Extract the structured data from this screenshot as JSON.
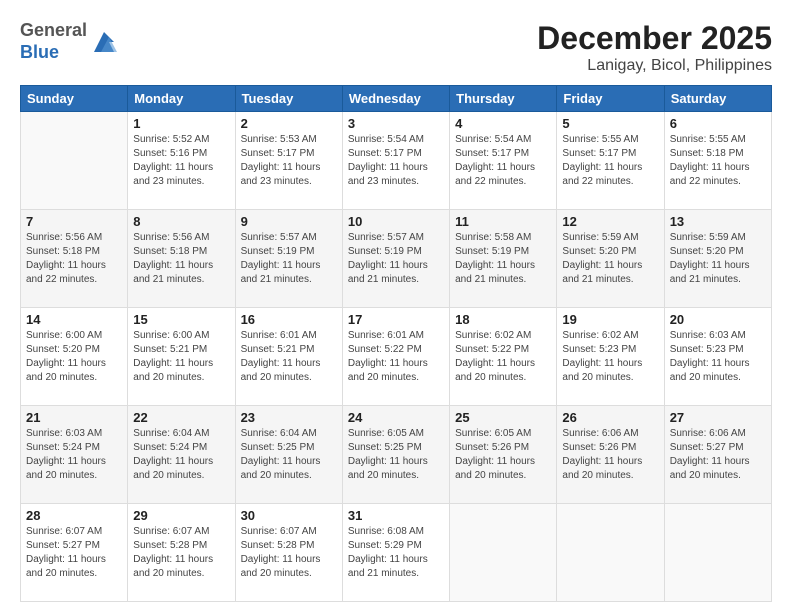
{
  "header": {
    "logo": {
      "text_general": "General",
      "text_blue": "Blue"
    },
    "title": "December 2025",
    "subtitle": "Lanigay, Bicol, Philippines"
  },
  "calendar": {
    "days_of_week": [
      "Sunday",
      "Monday",
      "Tuesday",
      "Wednesday",
      "Thursday",
      "Friday",
      "Saturday"
    ],
    "weeks": [
      [
        {
          "day": "",
          "info": ""
        },
        {
          "day": "1",
          "info": "Sunrise: 5:52 AM\nSunset: 5:16 PM\nDaylight: 11 hours\nand 23 minutes."
        },
        {
          "day": "2",
          "info": "Sunrise: 5:53 AM\nSunset: 5:17 PM\nDaylight: 11 hours\nand 23 minutes."
        },
        {
          "day": "3",
          "info": "Sunrise: 5:54 AM\nSunset: 5:17 PM\nDaylight: 11 hours\nand 23 minutes."
        },
        {
          "day": "4",
          "info": "Sunrise: 5:54 AM\nSunset: 5:17 PM\nDaylight: 11 hours\nand 22 minutes."
        },
        {
          "day": "5",
          "info": "Sunrise: 5:55 AM\nSunset: 5:17 PM\nDaylight: 11 hours\nand 22 minutes."
        },
        {
          "day": "6",
          "info": "Sunrise: 5:55 AM\nSunset: 5:18 PM\nDaylight: 11 hours\nand 22 minutes."
        }
      ],
      [
        {
          "day": "7",
          "info": "Sunrise: 5:56 AM\nSunset: 5:18 PM\nDaylight: 11 hours\nand 22 minutes."
        },
        {
          "day": "8",
          "info": "Sunrise: 5:56 AM\nSunset: 5:18 PM\nDaylight: 11 hours\nand 21 minutes."
        },
        {
          "day": "9",
          "info": "Sunrise: 5:57 AM\nSunset: 5:19 PM\nDaylight: 11 hours\nand 21 minutes."
        },
        {
          "day": "10",
          "info": "Sunrise: 5:57 AM\nSunset: 5:19 PM\nDaylight: 11 hours\nand 21 minutes."
        },
        {
          "day": "11",
          "info": "Sunrise: 5:58 AM\nSunset: 5:19 PM\nDaylight: 11 hours\nand 21 minutes."
        },
        {
          "day": "12",
          "info": "Sunrise: 5:59 AM\nSunset: 5:20 PM\nDaylight: 11 hours\nand 21 minutes."
        },
        {
          "day": "13",
          "info": "Sunrise: 5:59 AM\nSunset: 5:20 PM\nDaylight: 11 hours\nand 21 minutes."
        }
      ],
      [
        {
          "day": "14",
          "info": "Sunrise: 6:00 AM\nSunset: 5:20 PM\nDaylight: 11 hours\nand 20 minutes."
        },
        {
          "day": "15",
          "info": "Sunrise: 6:00 AM\nSunset: 5:21 PM\nDaylight: 11 hours\nand 20 minutes."
        },
        {
          "day": "16",
          "info": "Sunrise: 6:01 AM\nSunset: 5:21 PM\nDaylight: 11 hours\nand 20 minutes."
        },
        {
          "day": "17",
          "info": "Sunrise: 6:01 AM\nSunset: 5:22 PM\nDaylight: 11 hours\nand 20 minutes."
        },
        {
          "day": "18",
          "info": "Sunrise: 6:02 AM\nSunset: 5:22 PM\nDaylight: 11 hours\nand 20 minutes."
        },
        {
          "day": "19",
          "info": "Sunrise: 6:02 AM\nSunset: 5:23 PM\nDaylight: 11 hours\nand 20 minutes."
        },
        {
          "day": "20",
          "info": "Sunrise: 6:03 AM\nSunset: 5:23 PM\nDaylight: 11 hours\nand 20 minutes."
        }
      ],
      [
        {
          "day": "21",
          "info": "Sunrise: 6:03 AM\nSunset: 5:24 PM\nDaylight: 11 hours\nand 20 minutes."
        },
        {
          "day": "22",
          "info": "Sunrise: 6:04 AM\nSunset: 5:24 PM\nDaylight: 11 hours\nand 20 minutes."
        },
        {
          "day": "23",
          "info": "Sunrise: 6:04 AM\nSunset: 5:25 PM\nDaylight: 11 hours\nand 20 minutes."
        },
        {
          "day": "24",
          "info": "Sunrise: 6:05 AM\nSunset: 5:25 PM\nDaylight: 11 hours\nand 20 minutes."
        },
        {
          "day": "25",
          "info": "Sunrise: 6:05 AM\nSunset: 5:26 PM\nDaylight: 11 hours\nand 20 minutes."
        },
        {
          "day": "26",
          "info": "Sunrise: 6:06 AM\nSunset: 5:26 PM\nDaylight: 11 hours\nand 20 minutes."
        },
        {
          "day": "27",
          "info": "Sunrise: 6:06 AM\nSunset: 5:27 PM\nDaylight: 11 hours\nand 20 minutes."
        }
      ],
      [
        {
          "day": "28",
          "info": "Sunrise: 6:07 AM\nSunset: 5:27 PM\nDaylight: 11 hours\nand 20 minutes."
        },
        {
          "day": "29",
          "info": "Sunrise: 6:07 AM\nSunset: 5:28 PM\nDaylight: 11 hours\nand 20 minutes."
        },
        {
          "day": "30",
          "info": "Sunrise: 6:07 AM\nSunset: 5:28 PM\nDaylight: 11 hours\nand 20 minutes."
        },
        {
          "day": "31",
          "info": "Sunrise: 6:08 AM\nSunset: 5:29 PM\nDaylight: 11 hours\nand 21 minutes."
        },
        {
          "day": "",
          "info": ""
        },
        {
          "day": "",
          "info": ""
        },
        {
          "day": "",
          "info": ""
        }
      ]
    ]
  }
}
